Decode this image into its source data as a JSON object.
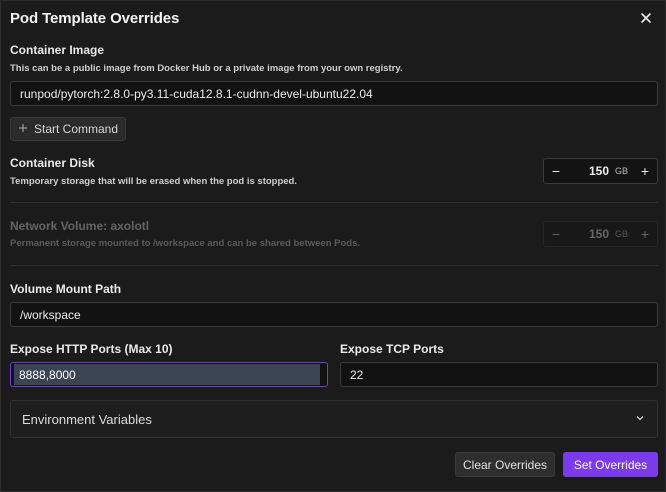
{
  "dialog": {
    "title": "Pod Template Overrides"
  },
  "container_image": {
    "label": "Container Image",
    "description": "This can be a public image from Docker Hub or a private image from your own registry.",
    "value": "runpod/pytorch:2.8.0-py3.11-cuda12.8.1-cudnn-devel-ubuntu22.04"
  },
  "start_command": {
    "label": "Start Command",
    "icon": "plus-icon"
  },
  "container_disk": {
    "label": "Container Disk",
    "description": "Temporary storage that will be erased when the pod is stopped.",
    "value": "150",
    "unit": "GB"
  },
  "network_volume": {
    "label": "Network Volume: axolotl",
    "description": "Permanent storage mounted to /workspace and can be shared between Pods.",
    "value": "150",
    "unit": "GB"
  },
  "volume_mount": {
    "label": "Volume Mount Path",
    "value": "/workspace"
  },
  "http_ports": {
    "label": "Expose HTTP Ports (Max 10)",
    "value": "8888,8000"
  },
  "tcp_ports": {
    "label": "Expose TCP Ports",
    "value": "22"
  },
  "env_vars": {
    "label": "Environment Variables"
  },
  "footer": {
    "clear_label": "Clear Overrides",
    "set_label": "Set Overrides"
  },
  "colors": {
    "accent": "#7c3aed",
    "accent_border": "#6d3fe0",
    "background": "#1b1b1b"
  }
}
